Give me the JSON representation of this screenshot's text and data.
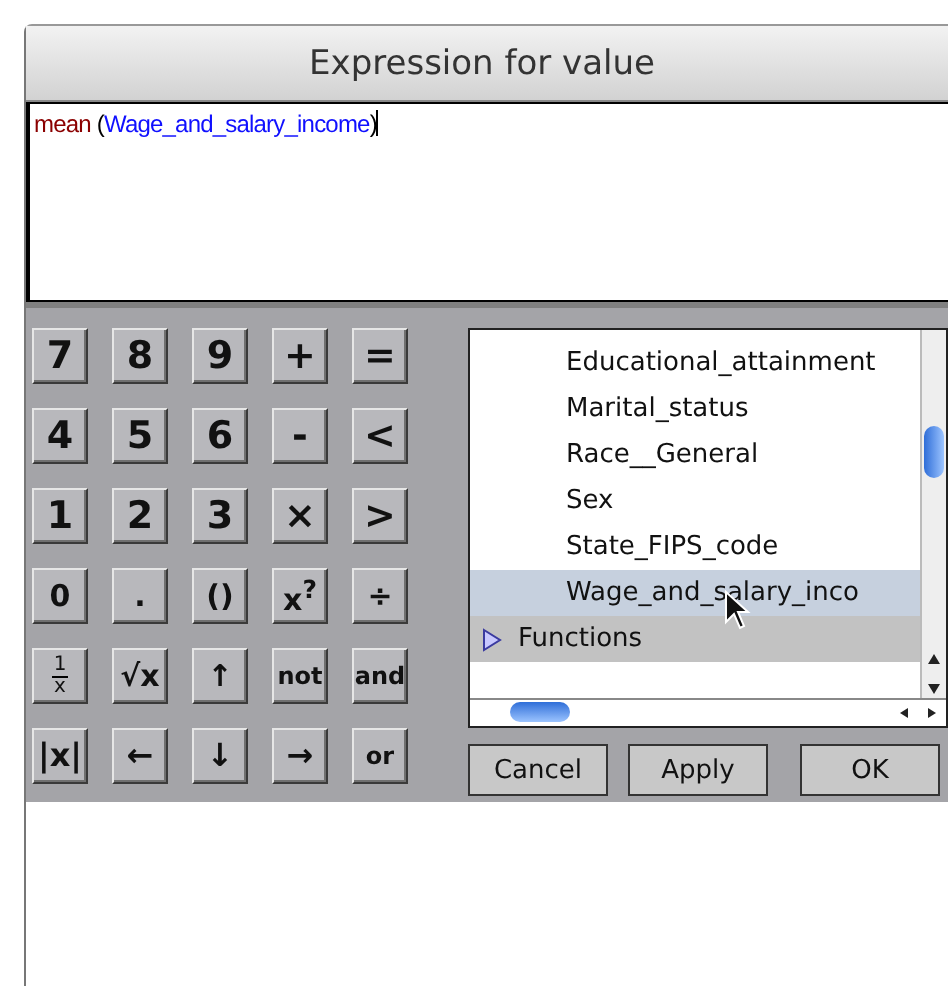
{
  "window": {
    "title": "Expression for value"
  },
  "expression": {
    "function": "mean",
    "open": "(",
    "argument": "Wage_and_salary_income",
    "close": ")"
  },
  "keypad": [
    {
      "label": "7"
    },
    {
      "label": "8"
    },
    {
      "label": "9"
    },
    {
      "label": "+"
    },
    {
      "label": "="
    },
    {
      "label": "4"
    },
    {
      "label": "5"
    },
    {
      "label": "6"
    },
    {
      "label": "-"
    },
    {
      "label": "<"
    },
    {
      "label": "1"
    },
    {
      "label": "2"
    },
    {
      "label": "3"
    },
    {
      "label": "×"
    },
    {
      "label": ">"
    },
    {
      "label": "0"
    },
    {
      "label": "."
    },
    {
      "label": "()"
    },
    {
      "label": "x$^{?}$"
    },
    {
      "label": "÷"
    },
    {
      "label": "1",
      "kind": "fraction",
      "denominator": "x"
    },
    {
      "label": "√x"
    },
    {
      "label": "↑"
    },
    {
      "label": "not"
    },
    {
      "label": "and"
    },
    {
      "label": "|x|"
    },
    {
      "label": "←"
    },
    {
      "label": "↓"
    },
    {
      "label": "→"
    },
    {
      "label": "or"
    }
  ],
  "list": {
    "items": [
      {
        "label": "Educational_attainment",
        "kind": "attribute",
        "selected": false
      },
      {
        "label": "Marital_status",
        "kind": "attribute",
        "selected": false
      },
      {
        "label": "Race__General",
        "kind": "attribute",
        "selected": false
      },
      {
        "label": "Sex",
        "kind": "attribute",
        "selected": false
      },
      {
        "label": "State_FIPS_code",
        "kind": "attribute",
        "selected": false
      },
      {
        "label": "Wage_and_salary_inco",
        "kind": "attribute",
        "selected": true
      },
      {
        "label": "Functions",
        "kind": "group",
        "expanded": false,
        "selected": false
      }
    ]
  },
  "buttons": [
    {
      "label": "Cancel"
    },
    {
      "label": "Apply"
    },
    {
      "label": "OK"
    }
  ]
}
